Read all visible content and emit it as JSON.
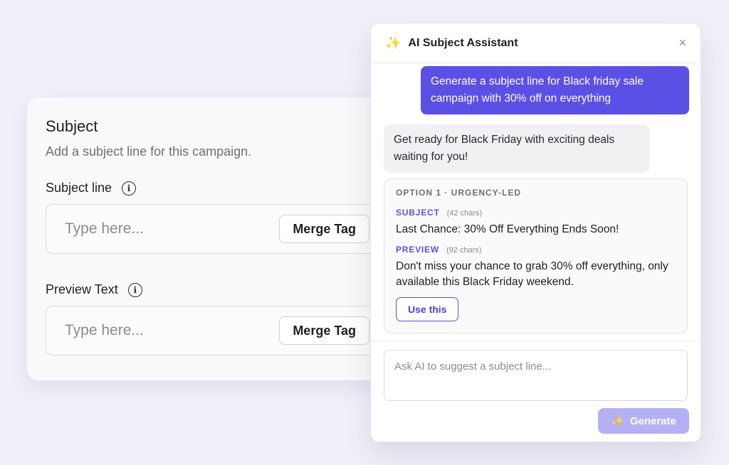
{
  "subject_card": {
    "title": "Subject",
    "description": "Add a subject line for this campaign.",
    "subject_field": {
      "label": "Subject line",
      "placeholder": "Type here...",
      "merge_button": "Merge Tag"
    },
    "preview_field": {
      "label": "Preview Text",
      "placeholder": "Type here...",
      "merge_button": "Merge Tag"
    },
    "info_icon_glyph": "i"
  },
  "ai_panel": {
    "title": "AI Subject Assistant",
    "sparkle_icon": "✨",
    "close_icon": "×",
    "user_message": "Generate a subject line for Black friday sale campaign with 30% off on everything",
    "ai_message": "Get ready for Black Friday with exciting deals waiting for you!",
    "option": {
      "title": "OPTION 1 · URGENCY-LED",
      "subject_label": "SUBJECT",
      "subject_count": "(42 chars)",
      "subject_text": "Last Chance: 30% Off Everything Ends Soon!",
      "preview_label": "PREVIEW",
      "preview_count": "(92 chars)",
      "preview_text": "Don't miss your chance to grab 30% off everything, only available this Black Friday weekend.",
      "use_button": "Use this"
    },
    "composer": {
      "placeholder": "Ask AI to suggest a subject line...",
      "generate_button": "Generate"
    }
  },
  "colors": {
    "accent": "#5b50e6",
    "accent_disabled": "#b4b0f4",
    "background": "#f1f0f9"
  }
}
